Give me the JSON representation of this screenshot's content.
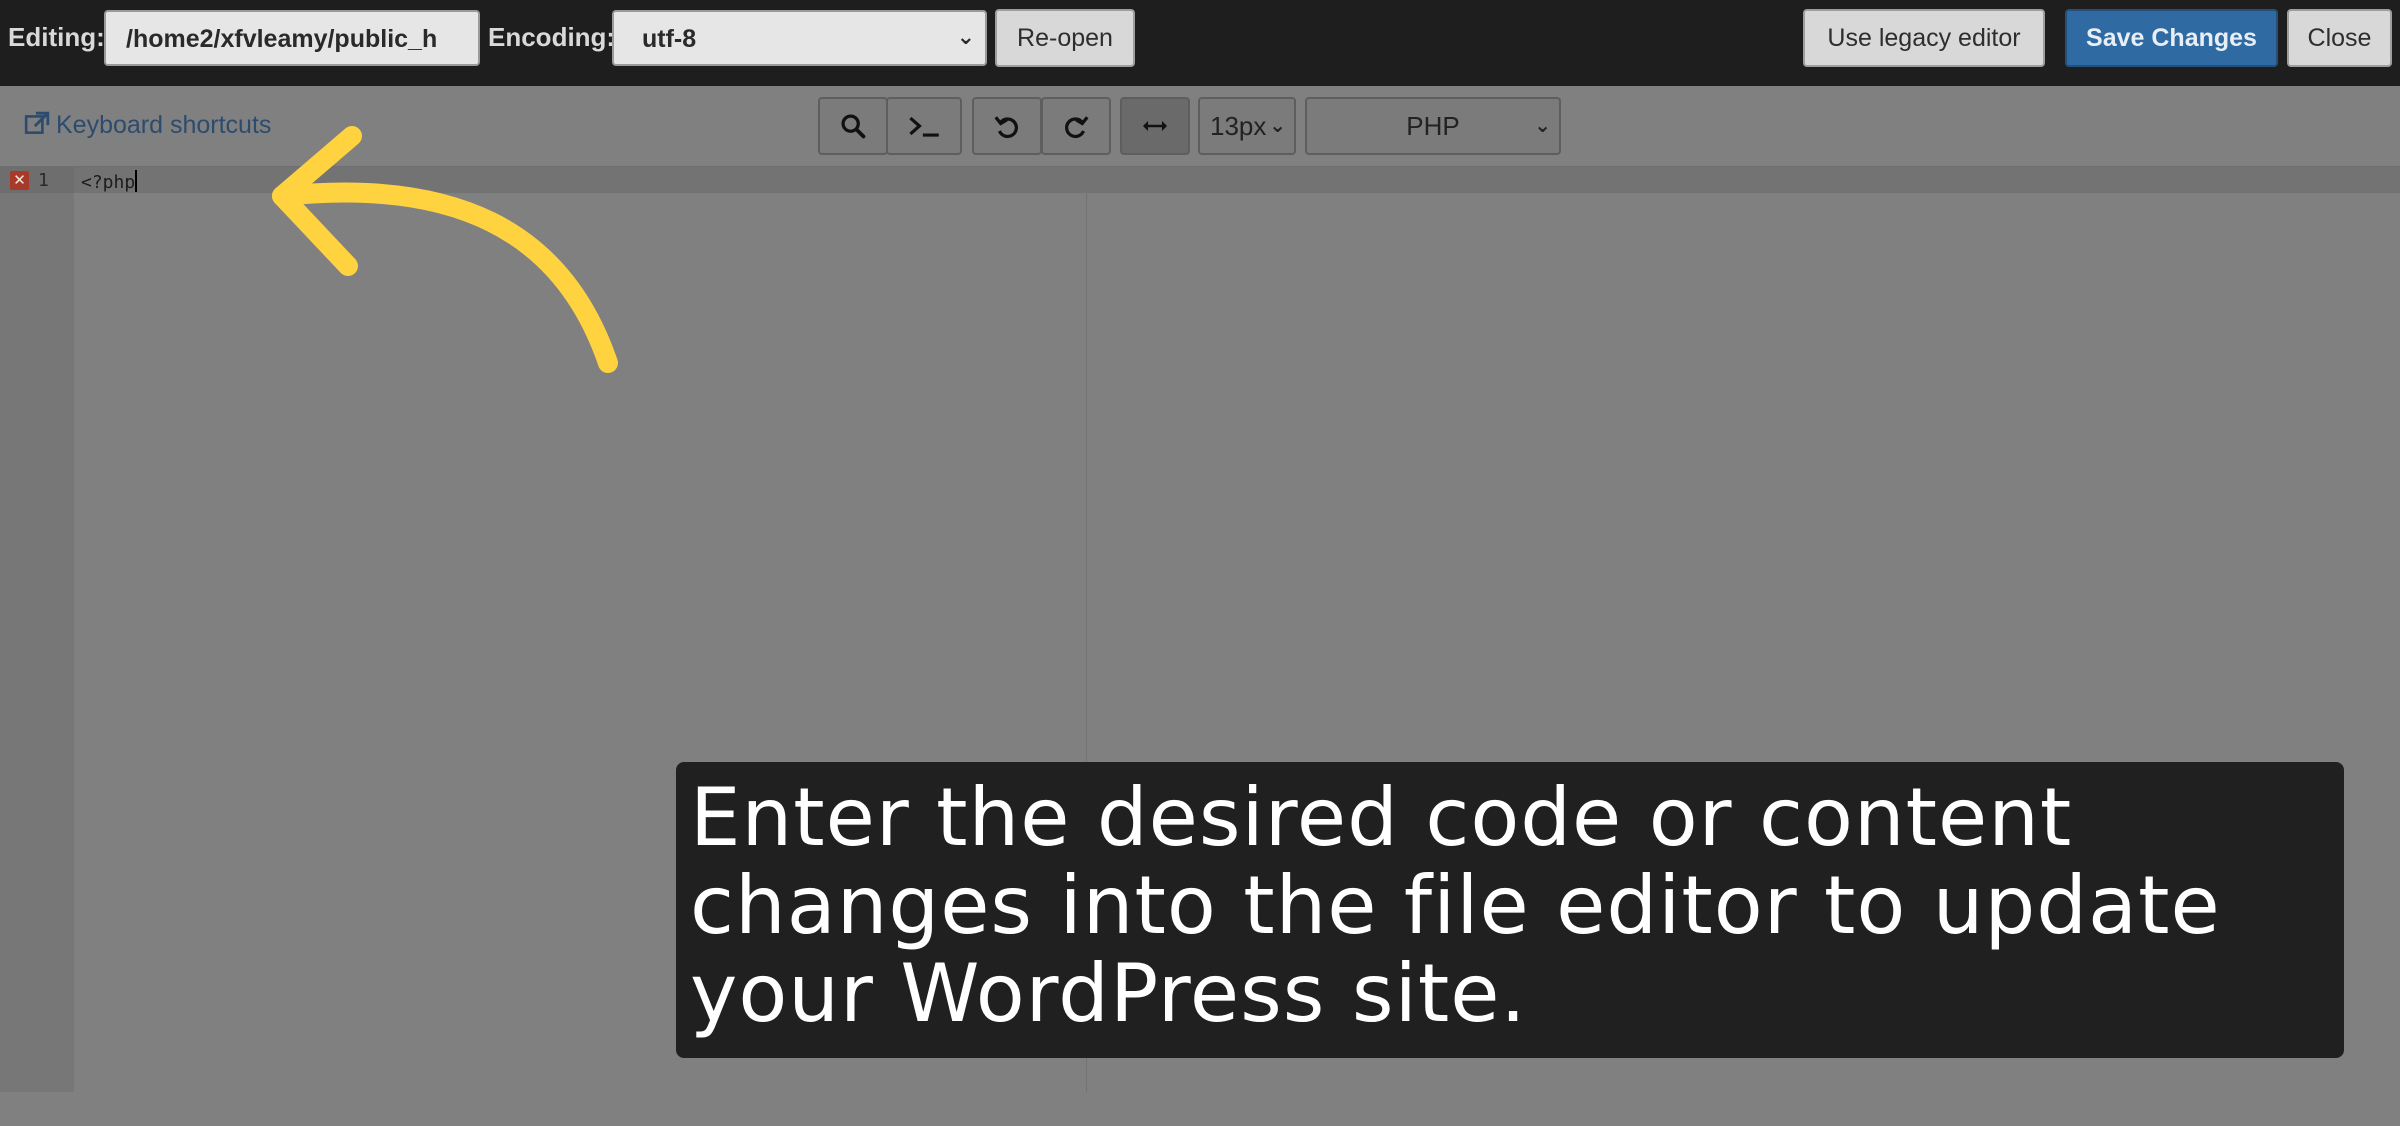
{
  "header": {
    "editing_label": "Editing:",
    "path_value": "/home2/xfvleamy/public_h",
    "encoding_label": "Encoding:",
    "encoding_value": "utf-8",
    "reopen_label": "Re-open",
    "legacy_label": "Use legacy editor",
    "save_label": "Save Changes",
    "close_label": "Close"
  },
  "toolbar": {
    "keyboard_shortcuts": "Keyboard shortcuts",
    "font_size": "13px",
    "mode": "PHP",
    "icons": [
      "search-icon",
      "terminal-icon",
      "undo-icon",
      "redo-icon",
      "wrap-toggle-icon"
    ]
  },
  "editor": {
    "line_number": "1",
    "code": "<?php",
    "error_marker": "✕"
  },
  "overlay": {
    "caption": "Enter the desired code or content changes into the file editor to update your WordPress site.",
    "arrow_color": "#FFD23F"
  },
  "colors": {
    "primary": "#2f6aa3",
    "topbar": "#1e1e1e",
    "error": "#a83a2a"
  }
}
